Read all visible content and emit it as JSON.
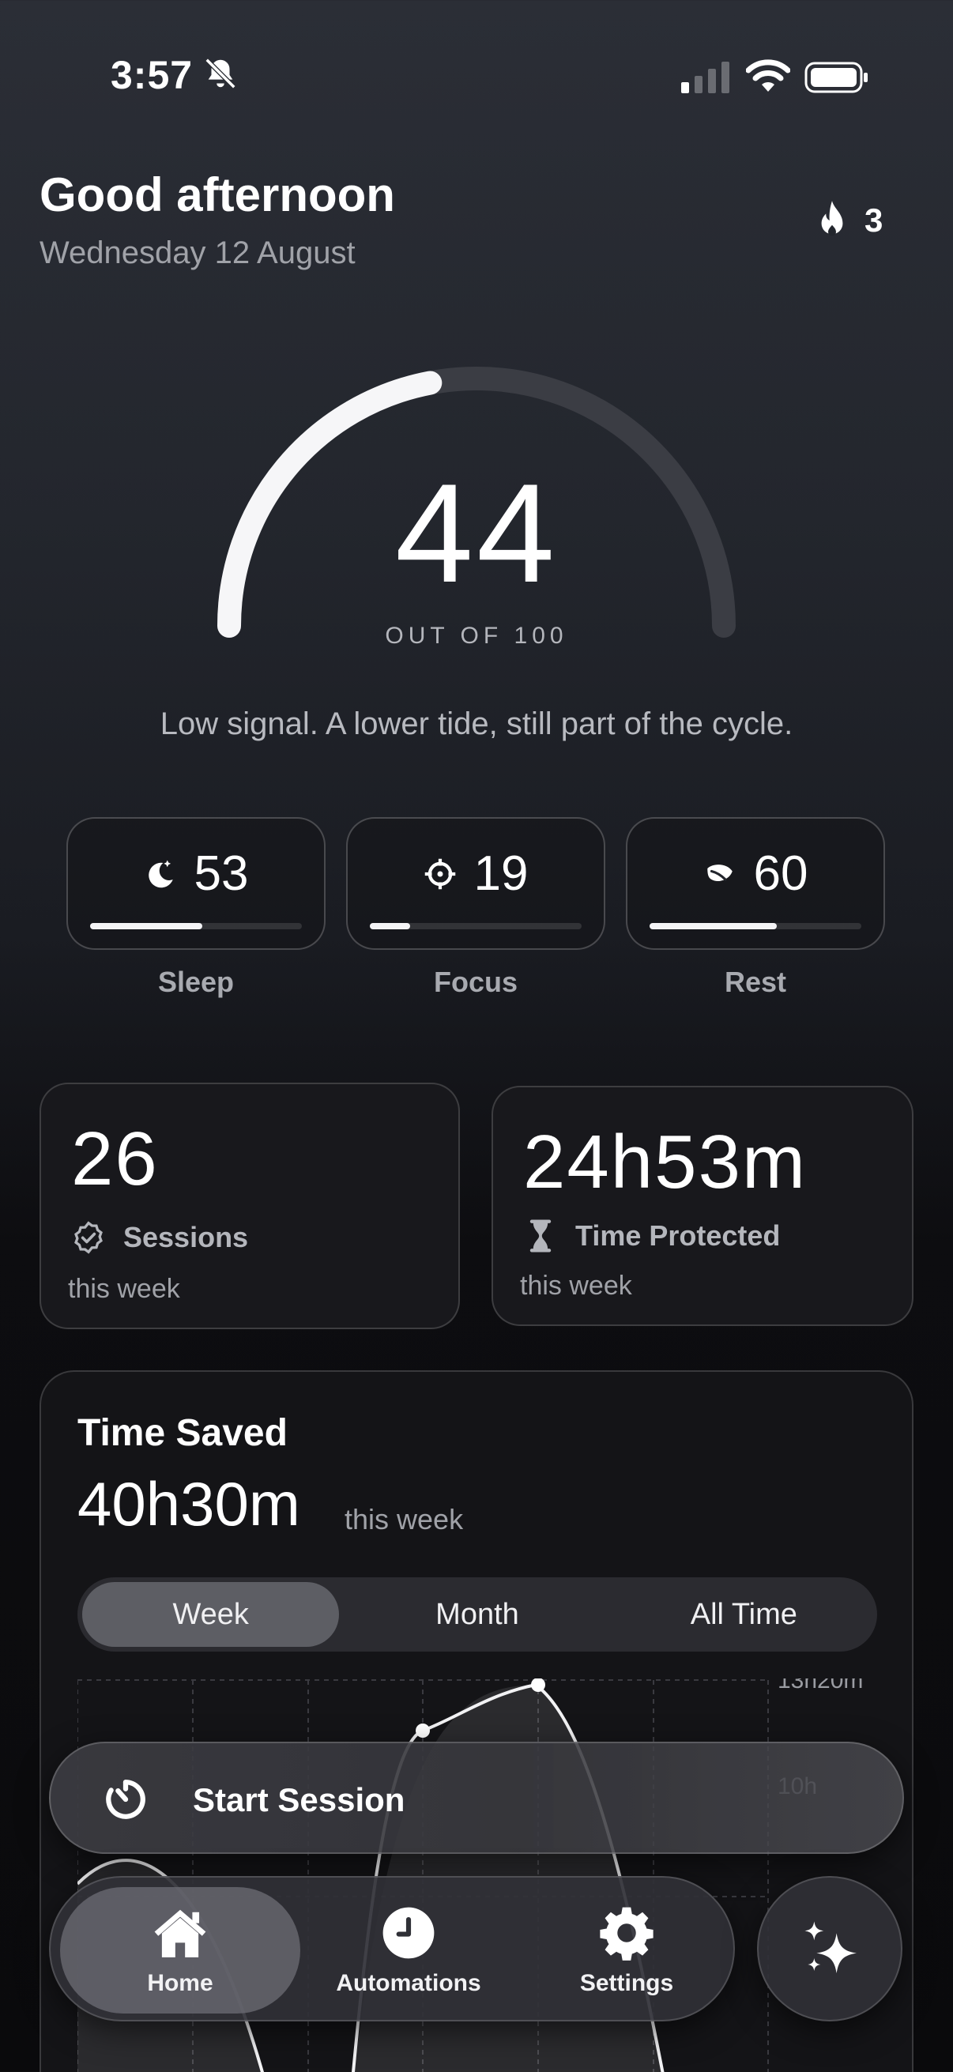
{
  "status": {
    "time": "3:57",
    "icons": [
      "bell-slash-icon",
      "cellular-signal-icon",
      "wifi-icon",
      "battery-icon"
    ]
  },
  "header": {
    "greeting": "Good afternoon",
    "date": "Wednesday 12 August",
    "streak_icon": "flame-icon",
    "streak_count": "3"
  },
  "score": {
    "value": "44",
    "max_label": "OUT OF 100",
    "fraction": 0.44,
    "tagline": "Low signal. A lower tide, still part of the cycle."
  },
  "metrics": [
    {
      "icon": "moon-icon",
      "value": "53",
      "label": "Sleep",
      "fraction": 0.53
    },
    {
      "icon": "crosshair-icon",
      "value": "19",
      "label": "Focus",
      "fraction": 0.19
    },
    {
      "icon": "leaf-icon",
      "value": "60",
      "label": "Rest",
      "fraction": 0.6
    }
  ],
  "stats": {
    "sessions": {
      "value": "26",
      "label": "Sessions",
      "sub": "this week",
      "icon": "badge-check-icon"
    },
    "protected": {
      "value": "24h53m",
      "label": "Time Protected",
      "sub": "this week",
      "icon": "hourglass-icon"
    }
  },
  "time_saved": {
    "title": "Time Saved",
    "value": "40h30m",
    "sub": "this week",
    "tabs": [
      "Week",
      "Month",
      "All Time"
    ],
    "active_tab": "Week",
    "chart_data": {
      "type": "area",
      "y_tick_labels": [
        "13h20m",
        "10h"
      ],
      "ylim_label": "13h20m",
      "grid": true
    }
  },
  "actions": {
    "start_session": "Start Session",
    "start_icon": "timer-icon"
  },
  "tabbar": {
    "items": [
      {
        "label": "Home",
        "icon": "home-icon",
        "active": true
      },
      {
        "label": "Automations",
        "icon": "clock-icon",
        "active": false
      },
      {
        "label": "Settings",
        "icon": "gear-icon",
        "active": false
      }
    ],
    "ai_icon": "sparkles-icon"
  },
  "colors": {
    "accent": "#ffffff",
    "track": "#3a3c42",
    "card": "#18181c"
  }
}
